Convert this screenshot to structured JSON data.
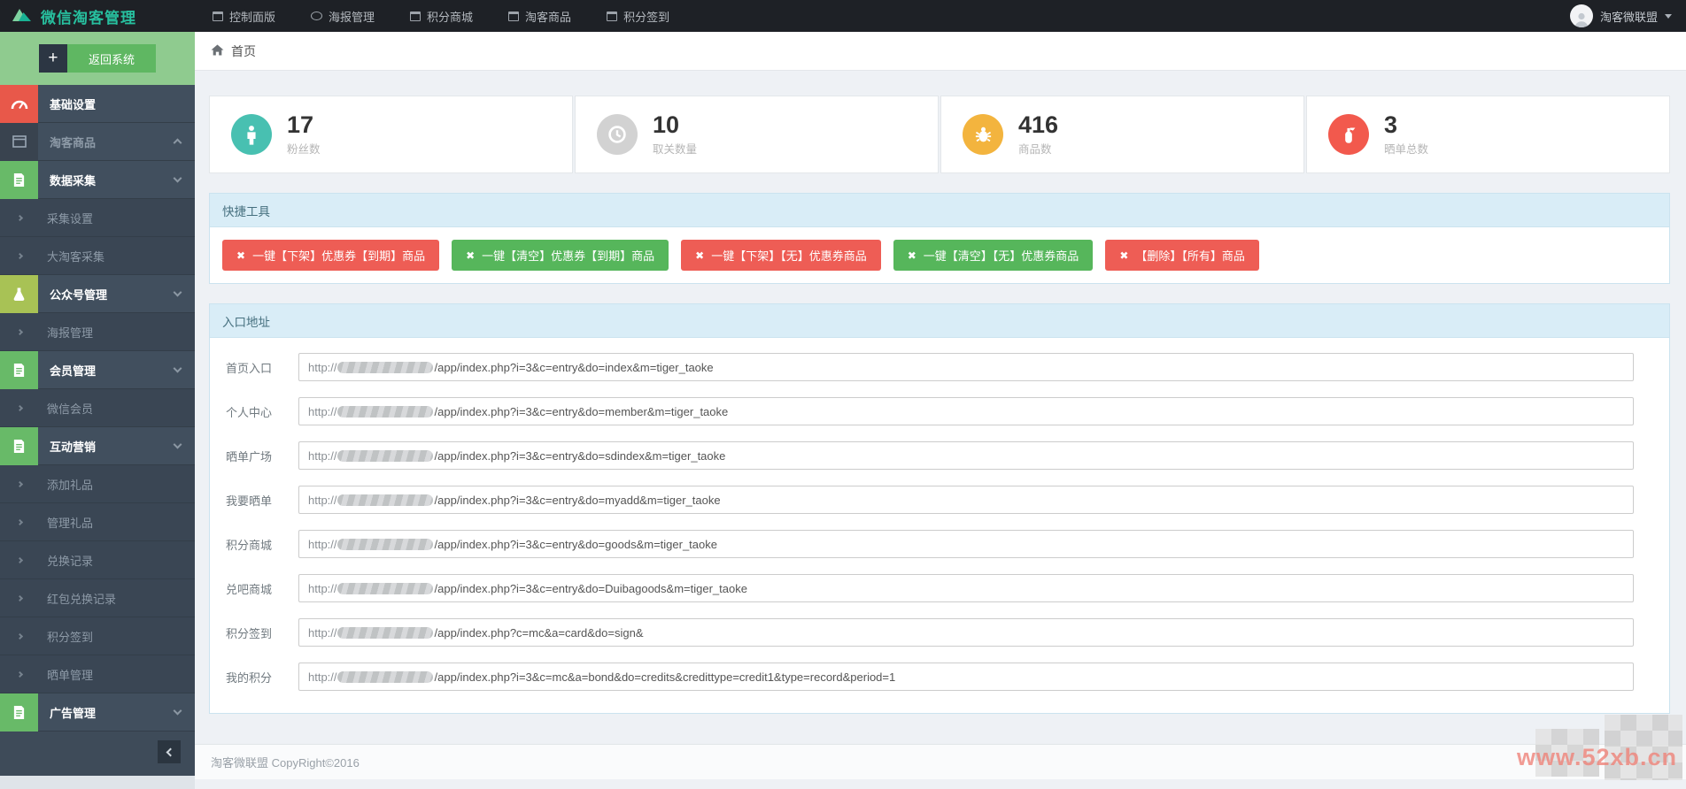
{
  "topbar": {
    "brand": "微信淘客管理",
    "nav": [
      {
        "label": "控制面版"
      },
      {
        "label": "海报管理"
      },
      {
        "label": "积分商城"
      },
      {
        "label": "淘客商品"
      },
      {
        "label": "积分签到"
      }
    ],
    "user_name": "淘客微联盟"
  },
  "sidebar": {
    "back_label": "返回系统",
    "items": [
      {
        "label": "基础设置",
        "type": "parent",
        "icon": "dashboard-icon",
        "icon_color": "#e8584a"
      },
      {
        "label": "淘客商品",
        "type": "parent",
        "icon": "window-icon",
        "icon_color": "#39434f",
        "chevron": "up"
      },
      {
        "label": "数据采集",
        "type": "parent",
        "icon": "document-icon",
        "icon_color": "#68ba68",
        "chevron": "down"
      },
      {
        "label": "采集设置",
        "type": "sub"
      },
      {
        "label": "大淘客采集",
        "type": "sub"
      },
      {
        "label": "公众号管理",
        "type": "parent",
        "icon": "flask-icon",
        "icon_color": "#a8c255",
        "chevron": "down"
      },
      {
        "label": "海报管理",
        "type": "sub"
      },
      {
        "label": "会员管理",
        "type": "parent",
        "icon": "document-icon",
        "icon_color": "#68ba68",
        "chevron": "down"
      },
      {
        "label": "微信会员",
        "type": "sub"
      },
      {
        "label": "互动营销",
        "type": "parent",
        "icon": "document-icon",
        "icon_color": "#68ba68",
        "chevron": "down"
      },
      {
        "label": "添加礼品",
        "type": "sub"
      },
      {
        "label": "管理礼品",
        "type": "sub"
      },
      {
        "label": "兑换记录",
        "type": "sub"
      },
      {
        "label": "红包兑换记录",
        "type": "sub"
      },
      {
        "label": "积分签到",
        "type": "sub"
      },
      {
        "label": "晒单管理",
        "type": "sub"
      },
      {
        "label": "广告管理",
        "type": "parent",
        "icon": "document-icon",
        "icon_color": "#68ba68",
        "chevron": "down"
      }
    ]
  },
  "breadcrumb": {
    "home_label": "首页"
  },
  "stats": [
    {
      "value": "17",
      "label": "粉丝数",
      "icon": "user-icon",
      "color": "#48c0b1"
    },
    {
      "value": "10",
      "label": "取关数量",
      "icon": "clock-icon",
      "color": "#d2d2d2"
    },
    {
      "value": "416",
      "label": "商品数",
      "icon": "bug-icon",
      "color": "#f3b43e"
    },
    {
      "value": "3",
      "label": "晒单总数",
      "icon": "fire-extinguisher-icon",
      "color": "#f2594d"
    }
  ],
  "quick_tools": {
    "title": "快捷工具",
    "buttons": [
      {
        "label": "一键【下架】优惠券【到期】商品",
        "color": "#ee5d55"
      },
      {
        "label": "一键【清空】优惠券【到期】商品",
        "color": "#56b65b"
      },
      {
        "label": "一键【下架】【无】优惠券商品",
        "color": "#ee5d55"
      },
      {
        "label": "一键【清空】【无】优惠券商品",
        "color": "#56b65b"
      },
      {
        "label": "【删除】【所有】商品",
        "color": "#ee5d55"
      }
    ]
  },
  "entry": {
    "title": "入口地址",
    "scheme": "http://",
    "rows": [
      {
        "label": "首页入口",
        "path": "/app/index.php?i=3&c=entry&do=index&m=tiger_taoke"
      },
      {
        "label": "个人中心",
        "path": "/app/index.php?i=3&c=entry&do=member&m=tiger_taoke"
      },
      {
        "label": "晒单广场",
        "path": "/app/index.php?i=3&c=entry&do=sdindex&m=tiger_taoke"
      },
      {
        "label": "我要晒单",
        "path": "/app/index.php?i=3&c=entry&do=myadd&m=tiger_taoke"
      },
      {
        "label": "积分商城",
        "path": "/app/index.php?i=3&c=entry&do=goods&m=tiger_taoke"
      },
      {
        "label": "兑吧商城",
        "path": "/app/index.php?i=3&c=entry&do=Duibagoods&m=tiger_taoke"
      },
      {
        "label": "积分签到",
        "path": "/app/index.php?c=mc&a=card&do=sign&"
      },
      {
        "label": "我的积分",
        "path": "/app/index.php?i=3&c=mc&a=bond&do=credits&credittype=credit1&type=record&period=1"
      }
    ]
  },
  "footer": {
    "copyright": "淘客微联盟 CopyRight©2016",
    "watermark": "www.52xb.cn"
  }
}
